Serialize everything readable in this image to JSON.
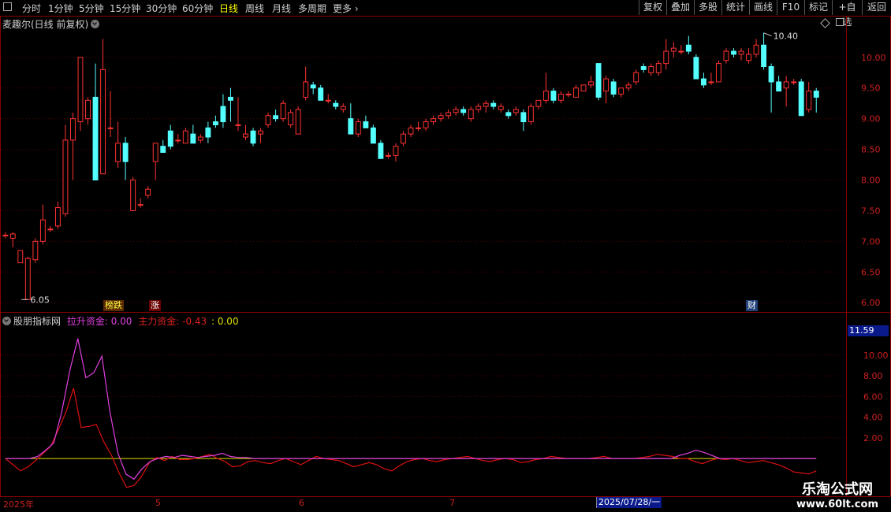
{
  "toolbar": {
    "periods": [
      "分时",
      "1分钟",
      "5分钟",
      "15分钟",
      "30分钟",
      "60分钟",
      "日线",
      "周线",
      "月线",
      "多周期",
      "更多"
    ],
    "active_period": "日线",
    "right_buttons": [
      "复权",
      "叠加",
      "多股",
      "统计",
      "画线",
      "F10",
      "标记",
      "+自选",
      "返回"
    ]
  },
  "main_chart": {
    "title": "麦趣尔(日线 前复权)",
    "high_marker": "10.40",
    "low_marker": "6.05",
    "tags": [
      {
        "text": "榜跌",
        "color": "#ffff40",
        "bg": "#5a2a00"
      },
      {
        "text": "涨",
        "color": "#ffffff",
        "bg": "#6a0000"
      },
      {
        "text": "财",
        "color": "#ffffff",
        "bg": "#20407a"
      }
    ]
  },
  "indicator": {
    "name": "股朋指标网",
    "series1_label": "拉升资金: 0.00",
    "series2_label": "主力资金: -0.43",
    "extra_label": ": 0.00",
    "current_value": "11.59"
  },
  "date_axis": {
    "labels": [
      "2025年",
      "5",
      "6",
      "7"
    ],
    "cursor_date": "2025/07/28/一"
  },
  "watermark": {
    "line1": "乐淘公式网",
    "line2": "www.60lt.com"
  },
  "chart_data": {
    "type": "candlestick",
    "price_axis": {
      "ticks": [
        6.0,
        6.5,
        7.0,
        7.5,
        8.0,
        8.5,
        9.0,
        9.5,
        10.0
      ],
      "range": [
        5.9,
        10.55
      ]
    },
    "indicator_axis": {
      "ticks": [
        2.0,
        4.0,
        6.0,
        8.0,
        10.0
      ],
      "range": [
        -3.5,
        12.5
      ]
    },
    "candles": [
      [
        7.1,
        7.15,
        7.05,
        7.1
      ],
      [
        7.05,
        7.15,
        6.9,
        7.12
      ],
      [
        6.65,
        6.85,
        6.65,
        6.85
      ],
      [
        6.05,
        6.75,
        6.05,
        6.72
      ],
      [
        6.7,
        7.05,
        6.65,
        7.0
      ],
      [
        7.0,
        7.6,
        6.95,
        7.35
      ],
      [
        7.2,
        7.25,
        7.15,
        7.2
      ],
      [
        7.25,
        7.65,
        7.2,
        7.55
      ],
      [
        7.45,
        8.9,
        7.4,
        8.65
      ],
      [
        8.65,
        9.1,
        8.0,
        9.0
      ],
      [
        8.95,
        10.0,
        8.8,
        10.0
      ],
      [
        9.0,
        9.35,
        8.9,
        9.3
      ],
      [
        9.35,
        9.9,
        8.0,
        8.0
      ],
      [
        8.1,
        10.3,
        8.1,
        9.8
      ],
      [
        8.85,
        9.45,
        8.7,
        8.85
      ],
      [
        8.3,
        8.95,
        8.2,
        8.6
      ],
      [
        8.6,
        8.7,
        8.0,
        8.3
      ],
      [
        7.5,
        8.05,
        7.5,
        8.0
      ],
      [
        7.6,
        7.7,
        7.55,
        7.6
      ],
      [
        7.75,
        7.9,
        7.7,
        7.85
      ],
      [
        8.3,
        8.6,
        8.0,
        8.6
      ],
      [
        8.55,
        8.65,
        8.45,
        8.45
      ],
      [
        8.8,
        8.9,
        8.5,
        8.55
      ],
      [
        8.65,
        8.75,
        8.6,
        8.65
      ],
      [
        8.6,
        8.85,
        8.6,
        8.8
      ],
      [
        8.75,
        8.9,
        8.6,
        8.6
      ],
      [
        8.65,
        8.75,
        8.6,
        8.7
      ],
      [
        8.85,
        8.95,
        8.6,
        8.7
      ],
      [
        8.95,
        9.05,
        8.85,
        8.9
      ],
      [
        9.2,
        9.4,
        8.85,
        8.95
      ],
      [
        9.35,
        9.5,
        8.95,
        9.3
      ],
      [
        8.9,
        9.35,
        8.8,
        8.9
      ],
      [
        8.7,
        8.9,
        8.65,
        8.75
      ],
      [
        8.8,
        8.85,
        8.55,
        8.6
      ],
      [
        8.75,
        8.85,
        8.6,
        8.8
      ],
      [
        8.9,
        9.1,
        8.85,
        9.05
      ],
      [
        9.05,
        9.15,
        8.95,
        9.0
      ],
      [
        9.0,
        9.3,
        8.95,
        9.25
      ],
      [
        8.9,
        9.15,
        8.85,
        9.1
      ],
      [
        8.75,
        9.2,
        8.75,
        9.15
      ],
      [
        9.35,
        9.85,
        9.3,
        9.6
      ],
      [
        9.55,
        9.6,
        9.4,
        9.5
      ],
      [
        9.5,
        9.55,
        9.3,
        9.3
      ],
      [
        9.3,
        9.4,
        9.25,
        9.3
      ],
      [
        9.25,
        9.3,
        9.15,
        9.2
      ],
      [
        9.15,
        9.25,
        9.1,
        9.2
      ],
      [
        9.0,
        9.25,
        8.75,
        8.75
      ],
      [
        8.75,
        9.0,
        8.7,
        8.95
      ],
      [
        8.95,
        9.05,
        8.85,
        8.85
      ],
      [
        8.85,
        8.9,
        8.6,
        8.6
      ],
      [
        8.6,
        8.65,
        8.35,
        8.35
      ],
      [
        8.4,
        8.45,
        8.35,
        8.4
      ],
      [
        8.4,
        8.6,
        8.3,
        8.55
      ],
      [
        8.6,
        8.8,
        8.55,
        8.75
      ],
      [
        8.75,
        8.9,
        8.7,
        8.85
      ],
      [
        8.85,
        8.95,
        8.8,
        8.85
      ],
      [
        8.85,
        9.0,
        8.8,
        8.95
      ],
      [
        8.95,
        9.05,
        8.9,
        9.0
      ],
      [
        9.0,
        9.1,
        8.95,
        9.05
      ],
      [
        9.05,
        9.15,
        9.0,
        9.1
      ],
      [
        9.1,
        9.2,
        9.05,
        9.15
      ],
      [
        9.15,
        9.2,
        9.05,
        9.1
      ],
      [
        9.0,
        9.2,
        8.95,
        9.15
      ],
      [
        9.15,
        9.25,
        9.1,
        9.2
      ],
      [
        9.2,
        9.3,
        9.1,
        9.25
      ],
      [
        9.25,
        9.3,
        9.15,
        9.2
      ],
      [
        9.15,
        9.25,
        9.1,
        9.2
      ],
      [
        9.1,
        9.15,
        9.0,
        9.05
      ],
      [
        9.1,
        9.2,
        9.05,
        9.15
      ],
      [
        9.1,
        9.15,
        8.8,
        8.95
      ],
      [
        8.95,
        9.25,
        8.9,
        9.2
      ],
      [
        9.2,
        9.3,
        9.15,
        9.3
      ],
      [
        9.3,
        9.75,
        9.25,
        9.45
      ],
      [
        9.45,
        9.5,
        9.25,
        9.3
      ],
      [
        9.3,
        9.45,
        9.25,
        9.4
      ],
      [
        9.4,
        9.45,
        9.35,
        9.4
      ],
      [
        9.35,
        9.55,
        9.35,
        9.5
      ],
      [
        9.45,
        9.55,
        9.45,
        9.55
      ],
      [
        9.55,
        9.7,
        9.5,
        9.6
      ],
      [
        9.9,
        9.9,
        9.3,
        9.35
      ],
      [
        9.45,
        9.7,
        9.25,
        9.65
      ],
      [
        9.6,
        9.65,
        9.35,
        9.4
      ],
      [
        9.4,
        9.5,
        9.35,
        9.5
      ],
      [
        9.5,
        9.6,
        9.45,
        9.55
      ],
      [
        9.6,
        9.8,
        9.55,
        9.75
      ],
      [
        9.85,
        9.9,
        9.75,
        9.8
      ],
      [
        9.75,
        9.9,
        9.7,
        9.85
      ],
      [
        9.75,
        9.95,
        9.7,
        9.9
      ],
      [
        9.9,
        10.3,
        9.8,
        10.1
      ],
      [
        10.1,
        10.25,
        10.0,
        10.15
      ],
      [
        10.1,
        10.2,
        10.05,
        10.1
      ],
      [
        10.2,
        10.35,
        10.05,
        10.1
      ],
      [
        10.0,
        10.05,
        9.65,
        9.65
      ],
      [
        9.65,
        9.75,
        9.5,
        9.55
      ],
      [
        9.6,
        9.75,
        9.55,
        9.6
      ],
      [
        9.6,
        9.95,
        9.6,
        9.9
      ],
      [
        9.95,
        10.15,
        9.9,
        10.1
      ],
      [
        10.1,
        10.15,
        10.0,
        10.05
      ],
      [
        10.05,
        10.15,
        9.95,
        10.1
      ],
      [
        9.95,
        10.15,
        9.9,
        10.05
      ],
      [
        10.05,
        10.3,
        10.0,
        10.2
      ],
      [
        10.2,
        10.4,
        9.8,
        9.85
      ],
      [
        9.85,
        9.9,
        9.1,
        9.6
      ],
      [
        9.6,
        9.7,
        9.45,
        9.45
      ],
      [
        9.5,
        9.7,
        9.2,
        9.6
      ],
      [
        9.6,
        9.65,
        9.55,
        9.6
      ],
      [
        9.6,
        9.65,
        9.05,
        9.05
      ],
      [
        9.15,
        9.6,
        9.1,
        9.45
      ],
      [
        9.45,
        9.5,
        9.1,
        9.35
      ]
    ],
    "series": [
      {
        "name": "拉升资金",
        "color": "#e040e0",
        "values": [
          0,
          0,
          0,
          0,
          0.2,
          0.8,
          1.5,
          4.5,
          8.5,
          11.6,
          7.8,
          8.3,
          9.9,
          4.5,
          0.5,
          -1.5,
          -2,
          -1,
          -0.3,
          0,
          0.2,
          0.1,
          0.3,
          0.2,
          0.1,
          0.2,
          0.3,
          0.5,
          0.2,
          0.1,
          0.1,
          0,
          0,
          0,
          0,
          0,
          0,
          0,
          0,
          0,
          0,
          0,
          0,
          0,
          0,
          0,
          0,
          0,
          0,
          0,
          0,
          0,
          0,
          0,
          0,
          0,
          0,
          0,
          0,
          0,
          0,
          0,
          0,
          0,
          0,
          0,
          0,
          0,
          0,
          0,
          0,
          0,
          0,
          0,
          0,
          0,
          0,
          0,
          0,
          0,
          0,
          0,
          0,
          0,
          0.3,
          0.5,
          0.8,
          0.6,
          0.3,
          0,
          0,
          0,
          0,
          0,
          0,
          0,
          0,
          0,
          0,
          0,
          0,
          0
        ]
      },
      {
        "name": "主力资金",
        "color": "#dd1010",
        "values": [
          0,
          -0.6,
          -1.2,
          -0.8,
          -0.2,
          0.5,
          1.2,
          2.8,
          4.5,
          6.8,
          3.0,
          3.1,
          3.3,
          1.6,
          0.3,
          -1.4,
          -2.8,
          -2.6,
          -1.7,
          -0.4,
          0.1,
          -0.2,
          0.2,
          -0.1,
          -0.1,
          0,
          0.2,
          0.4,
          0,
          -0.3,
          -0.8,
          -0.7,
          -0.3,
          -0.2,
          -0.4,
          -0.5,
          -0.2,
          0,
          -0.3,
          -0.6,
          -0.2,
          0.2,
          0,
          -0.1,
          -0.2,
          -0.5,
          -0.8,
          -0.6,
          -0.4,
          -0.6,
          -1.0,
          -1.2,
          -0.7,
          -0.3,
          -0.1,
          0,
          -0.2,
          -0.3,
          -0.1,
          0,
          0.1,
          0.2,
          0,
          -0.2,
          -0.3,
          -0.1,
          0,
          -0.1,
          -0.4,
          -0.3,
          -0.1,
          0,
          0.2,
          0.1,
          0,
          0,
          0,
          0,
          0.1,
          0.2,
          0,
          0,
          0,
          0,
          0.1,
          0.2,
          0.4,
          0.3,
          0.2,
          0,
          0,
          -0.3,
          -0.5,
          -0.2,
          0,
          -0.1,
          0,
          -0.2,
          -0.4,
          -0.3,
          -0.2,
          -0.4,
          -0.6,
          -0.9,
          -1.3,
          -1.4,
          -1.5,
          -1.2
        ]
      },
      {
        "name": "",
        "color": "#e0e000",
        "values": [
          0,
          0,
          0,
          0,
          0,
          0,
          0,
          0,
          0,
          0,
          0,
          0,
          0,
          0,
          0,
          0,
          0,
          0,
          0,
          0,
          0,
          0,
          0,
          0,
          0,
          0,
          0,
          0,
          0,
          0,
          0,
          0,
          0,
          0,
          0,
          0,
          0,
          0,
          0,
          0,
          0,
          0,
          0,
          0,
          0,
          0,
          0,
          0,
          0,
          0,
          0,
          0,
          0,
          0,
          0,
          0,
          0,
          0,
          0,
          0,
          0,
          0,
          0,
          0,
          0,
          0,
          0,
          0,
          0,
          0,
          0,
          0,
          0,
          0,
          0,
          0,
          0,
          0,
          0,
          0,
          0,
          0,
          0,
          0,
          0,
          0,
          0,
          0,
          0,
          0,
          0,
          0,
          0,
          0,
          0,
          0,
          0,
          0,
          0,
          0,
          0,
          0,
          0,
          0,
          0,
          0,
          0,
          0,
          0
        ]
      }
    ]
  }
}
